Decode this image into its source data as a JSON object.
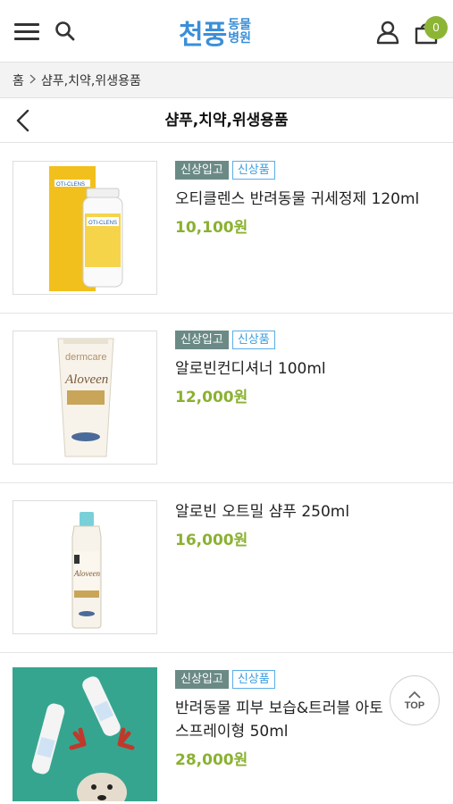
{
  "header": {
    "logo_main": "천풍",
    "logo_sub_top": "동물",
    "logo_sub_bottom": "병원",
    "cart_count": "0",
    "brand_color": "#3a8fd8",
    "accent_color": "#8db535"
  },
  "breadcrumb": {
    "home": "홈",
    "current": "샴푸,치약,위생용품"
  },
  "page": {
    "title": "샴푸,치약,위생용품"
  },
  "products": [
    {
      "badge_new_in": "신상입고",
      "badge_new": "신상품",
      "name": "오티클렌스 반려동물 귀세정제 120ml",
      "price": "10,100원",
      "image": "oti-clens-bottle-box",
      "img_text": "OTI-CLENS"
    },
    {
      "badge_new_in": "신상입고",
      "badge_new": "신상품",
      "name": "알로빈컨디셔너 100ml",
      "price": "12,000원",
      "image": "dermcare-aloveen-tube",
      "img_text_1": "dermcare",
      "img_text_2": "Aloveen"
    },
    {
      "name": "알로빈 오트밀 샴푸 250ml",
      "price": "16,000원",
      "image": "aloveen-shampoo-bottle",
      "img_text": "Aloveen"
    },
    {
      "badge_new_in": "신상입고",
      "badge_new": "신상품",
      "name_line1": "반려동물 피부 보습&트러블 아토 ",
      "name_line2": "스프레이형 50ml",
      "price": "28,000원",
      "image": "dog-with-spray-bottles"
    }
  ],
  "top_button": {
    "label": "TOP"
  }
}
